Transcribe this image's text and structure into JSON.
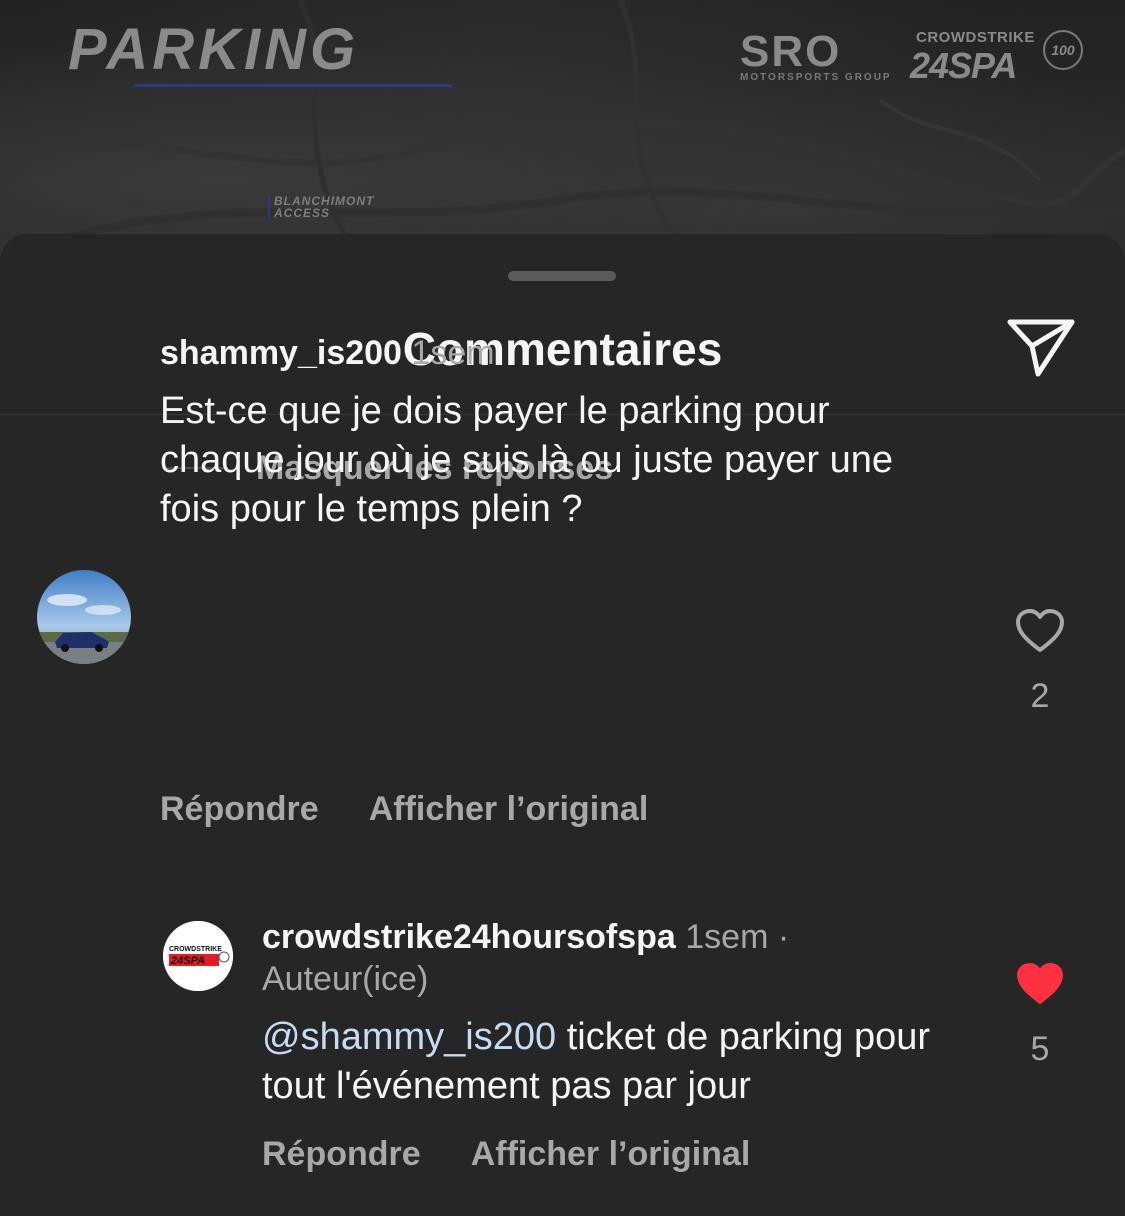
{
  "banner": {
    "title": "PARKING",
    "sponsor_logo": "SRO",
    "sponsor_sub": "MOTORSPORTS GROUP",
    "event_brand": "CROWDSTRIKE",
    "event_logo": "24SPA",
    "anniversary": "100",
    "access_line1": "BLANCHIMONT",
    "access_line2": "ACCESS"
  },
  "sheet": {
    "title": "Commentaires",
    "share_icon": "paper-plane-icon",
    "hide_replies": "Masquer les réponses"
  },
  "comments": [
    {
      "username": "shammy_is200",
      "time": "1sem",
      "text": "Est-ce que je dois payer le parking pour chaque jour où je suis là ou juste payer une fois pour le temps plein ?",
      "reply_label": "Répondre",
      "original_label": "Afficher l’original",
      "likes": "2",
      "liked": false
    },
    {
      "username": "crowdstrike24hoursofspa",
      "time": "1sem ·",
      "author_tag": "Auteur(ice)",
      "mention": "@shammy_is200",
      "text": " ticket de parking pour tout l'événement pas par jour",
      "reply_label": "Répondre",
      "original_label": "Afficher l’original",
      "likes": "5",
      "liked": true,
      "avatar_brand": "CROWDSTRIKE",
      "avatar_logo": "24SPA"
    }
  ],
  "colors": {
    "background": "#262626",
    "text_primary": "#f5f5f5",
    "text_secondary": "#a8a8a8",
    "mention": "#c6dcf5",
    "like_active": "#ff3040"
  }
}
